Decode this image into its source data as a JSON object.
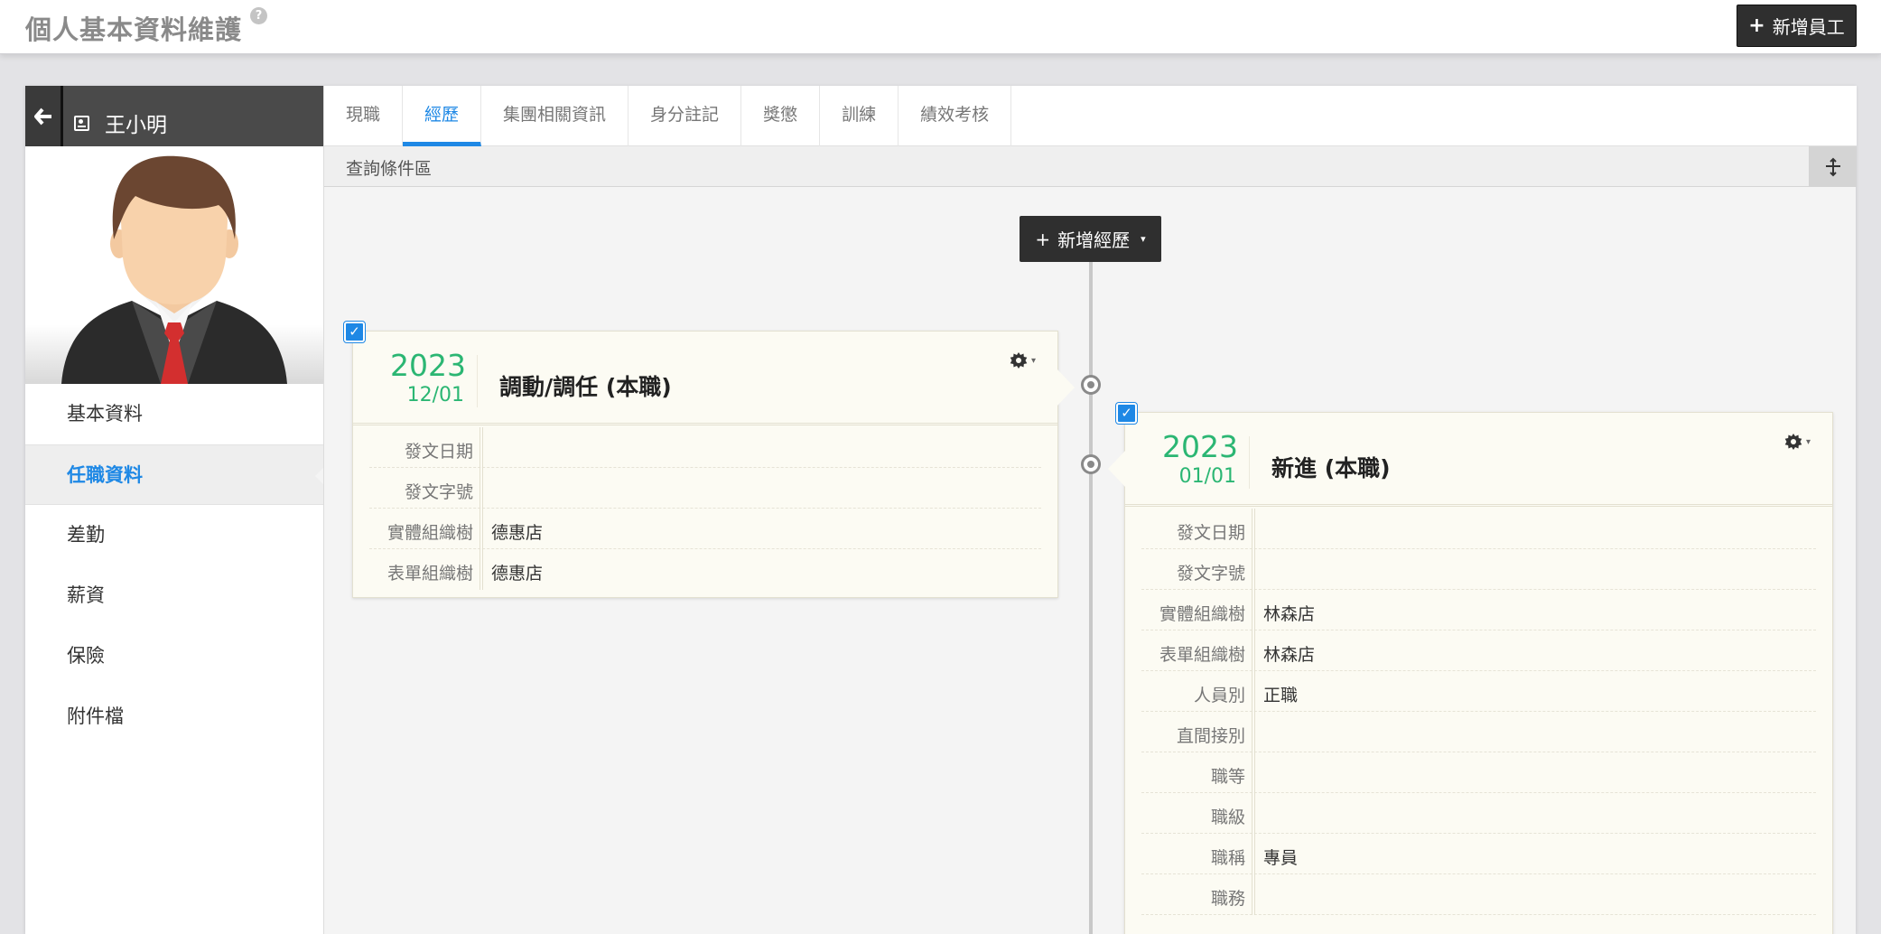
{
  "header": {
    "title": "個人基本資料維護",
    "help_icon": "?",
    "add_employee_label": "新增員工",
    "plus": "+"
  },
  "employee": {
    "name": "王小明"
  },
  "sidebar": {
    "items": [
      {
        "label": "基本資料"
      },
      {
        "label": "任職資料",
        "active": true
      },
      {
        "label": "差勤"
      },
      {
        "label": "薪資"
      },
      {
        "label": "保險"
      },
      {
        "label": "附件檔"
      }
    ]
  },
  "tabs": [
    {
      "label": "現職"
    },
    {
      "label": "經歷",
      "active": true
    },
    {
      "label": "集團相關資訊"
    },
    {
      "label": "身分註記"
    },
    {
      "label": "獎懲"
    },
    {
      "label": "訓練"
    },
    {
      "label": "績效考核"
    }
  ],
  "query": {
    "label": "查詢條件區"
  },
  "timeline": {
    "add_label": "新增經歷",
    "plus": "+",
    "caret": "▾",
    "checkmark": "✓"
  },
  "cards": [
    {
      "year": "2023",
      "month_day": "12/01",
      "title": "調動/調任 (本職)",
      "rows": [
        {
          "label": "發文日期",
          "value": ""
        },
        {
          "label": "發文字號",
          "value": ""
        },
        {
          "label": "實體組織樹",
          "value": "德惠店"
        },
        {
          "label": "表單組織樹",
          "value": "德惠店"
        }
      ]
    },
    {
      "year": "2023",
      "month_day": "01/01",
      "title": "新進 (本職)",
      "rows": [
        {
          "label": "發文日期",
          "value": ""
        },
        {
          "label": "發文字號",
          "value": ""
        },
        {
          "label": "實體組織樹",
          "value": "林森店"
        },
        {
          "label": "表單組織樹",
          "value": "林森店"
        },
        {
          "label": "人員別",
          "value": "正職"
        },
        {
          "label": "直間接別",
          "value": ""
        },
        {
          "label": "職等",
          "value": ""
        },
        {
          "label": "職級",
          "value": ""
        },
        {
          "label": "職稱",
          "value": "專員"
        },
        {
          "label": "職務",
          "value": ""
        }
      ]
    }
  ],
  "colors": {
    "accent_blue": "#1e88e5",
    "date_green": "#2bb673",
    "dark_button": "#2f2f2f"
  }
}
